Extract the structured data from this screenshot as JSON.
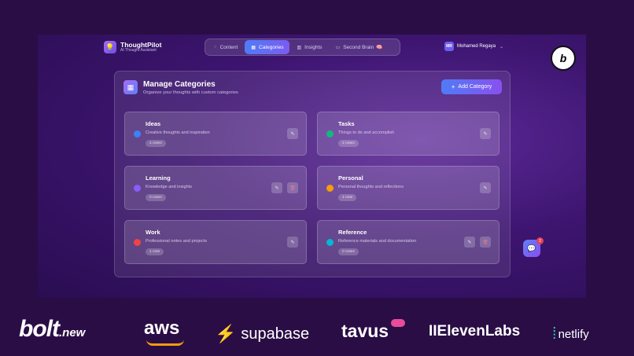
{
  "brand": {
    "title": "ThoughtPilot",
    "subtitle": "AI Thought Assistant",
    "logo_icon": "lightbulb-icon"
  },
  "nav": {
    "tabs": [
      {
        "label": "Content",
        "icon": "lightbulb-icon",
        "active": false
      },
      {
        "label": "Categories",
        "icon": "grid-icon",
        "active": true
      },
      {
        "label": "Insights",
        "icon": "chart-icon",
        "active": false
      },
      {
        "label": "Second Brain",
        "icon": "video-icon",
        "suffix": "🧠",
        "active": false
      }
    ]
  },
  "user": {
    "initials": "MR",
    "name": "Mohamed Regaya"
  },
  "badge": {
    "letter": "b"
  },
  "panel": {
    "title": "Manage Categories",
    "subtitle": "Organize your thoughts with custom categories",
    "add_button": "Add Category"
  },
  "categories": [
    {
      "name": "Ideas",
      "description": "Creative thoughts and inspiration",
      "count": "4 notes",
      "color": "#3b82f6",
      "deletable": false
    },
    {
      "name": "Tasks",
      "description": "Things to do and accomplish",
      "count": "2 notes",
      "color": "#10b981",
      "deletable": false
    },
    {
      "name": "Learning",
      "description": "Knowledge and insights",
      "count": "0 notes",
      "color": "#8b5cf6",
      "deletable": true
    },
    {
      "name": "Personal",
      "description": "Personal thoughts and reflections",
      "count": "1 note",
      "color": "#f59e0b",
      "deletable": false
    },
    {
      "name": "Work",
      "description": "Professional notes and projects",
      "count": "1 note",
      "color": "#ef4444",
      "deletable": false
    },
    {
      "name": "Reference",
      "description": "Reference materials and documentation",
      "count": "0 notes",
      "color": "#06b6d4",
      "deletable": true
    }
  ],
  "chat": {
    "badge_count": "2"
  },
  "sponsors": {
    "bolt": "bolt",
    "bolt_suffix": ".new",
    "aws": "aws",
    "supabase": "supabase",
    "tavus": "tavus",
    "elevenlabs": "IIElevenLabs",
    "netlify": "netlify"
  }
}
